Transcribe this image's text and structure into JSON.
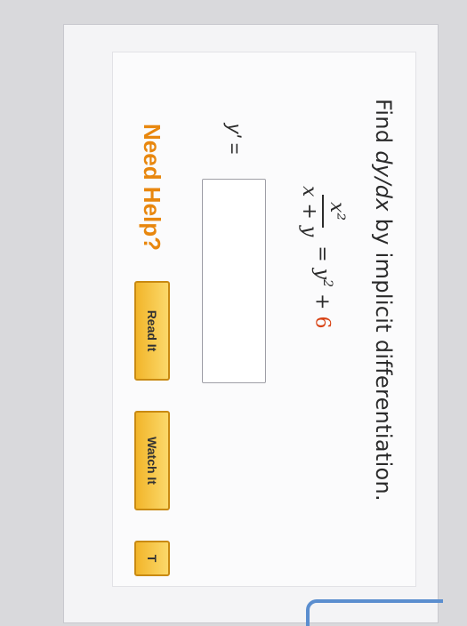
{
  "question": {
    "prompt_prefix": "Find ",
    "prompt_derivative": "dy/dx",
    "prompt_suffix": " by implicit differentiation."
  },
  "equation": {
    "numerator": "x²",
    "denominator": "x + y",
    "rhs_prefix": "= y",
    "rhs_exponent": "2",
    "rhs_plus": " + ",
    "rhs_constant": "6",
    "constant_color": "#d84315"
  },
  "answer": {
    "label": "y' =",
    "value": ""
  },
  "help": {
    "title": "Need Help?",
    "read_it": "Read It",
    "watch_it": "Watch It",
    "talk_partial": "T"
  }
}
